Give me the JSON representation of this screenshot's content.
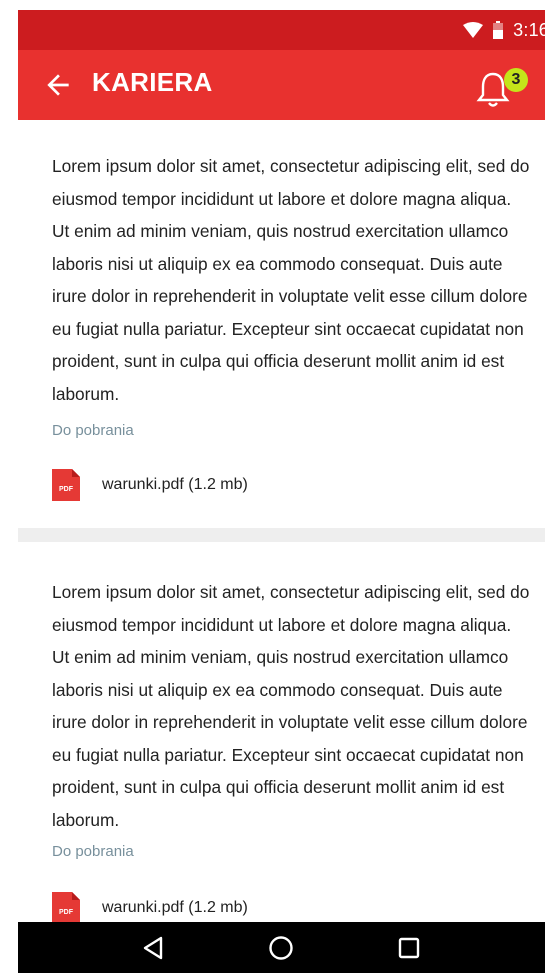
{
  "status_bar": {
    "time": "3:16",
    "wifi_icon": "wifi-icon",
    "battery_icon": "battery-icon"
  },
  "app_bar": {
    "title": "KARIERA",
    "back_icon": "back-arrow-icon",
    "notification_icon": "bell-icon",
    "notification_count": "3",
    "badge_color": "#c4e51a"
  },
  "colors": {
    "status_bar": "#cc1c1f",
    "app_bar": "#e8312f",
    "section_label": "#78909c",
    "pdf_icon": "#e53935"
  },
  "cards": [
    {
      "text": "Lorem ipsum dolor sit amet, consectetur adipiscing elit, sed do eiusmod tempor incididunt ut labore et dolore magna aliqua. Ut enim ad minim veniam, quis nostrud exercitation ullamco laboris nisi ut aliquip ex ea commodo consequat. Duis aute irure dolor in reprehenderit in voluptate velit esse cillum dolore eu fugiat nulla pariatur. Excepteur sint occaecat cupidatat non proident, sunt in culpa qui officia deserunt mollit anim id est laborum.",
      "downloads_label": "Do pobrania",
      "file": {
        "name": "warunki.pdf (1.2 mb)",
        "icon_text": "PDF"
      }
    },
    {
      "text": "Lorem ipsum dolor sit amet, consectetur adipiscing elit, sed do eiusmod tempor incididunt ut labore et dolore magna aliqua. Ut enim ad minim veniam, quis nostrud exercitation ullamco laboris nisi ut aliquip ex ea commodo consequat. Duis aute irure dolor in reprehenderit in voluptate velit esse cillum dolore eu fugiat nulla pariatur. Excepteur sint occaecat cupidatat non proident, sunt in culpa qui officia deserunt mollit anim id est laborum.",
      "downloads_label": "Do pobrania",
      "file": {
        "name": "warunki.pdf (1.2 mb)",
        "icon_text": "PDF"
      }
    }
  ],
  "nav_bar": {
    "back_icon": "nav-back-icon",
    "home_icon": "nav-home-icon",
    "recents_icon": "nav-recents-icon"
  }
}
